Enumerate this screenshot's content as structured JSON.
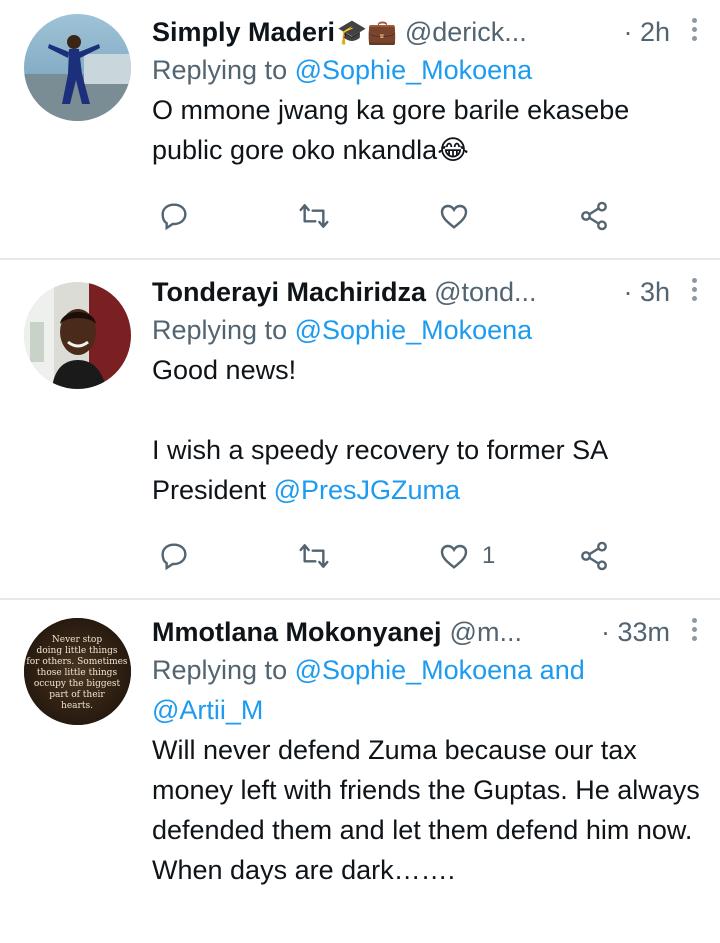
{
  "tweets": [
    {
      "name": "Simply Maderi",
      "badges": "🎓💼",
      "handle": "@derick...",
      "time": "· 2h",
      "reply_prefix": "Replying to",
      "reply_mention": "@Sophie_Mokoena",
      "text": "O mmone jwang ka gore barile ekasebe public gore oko nkandla😂",
      "likes": ""
    },
    {
      "name": "Tonderayi Machiridza",
      "handle": "@tond...",
      "time": "· 3h",
      "reply_prefix": "Replying to",
      "reply_mention": "@Sophie_Mokoena",
      "text_line1": "Good news!",
      "text_line2": "I wish a speedy recovery to  former SA President",
      "text_mention": "@PresJGZuma",
      "likes": "1"
    },
    {
      "name": "Mmotlana Mokonyanej",
      "handle": "@m...",
      "time": "· 33m",
      "reply_prefix": "Replying to",
      "reply_mention": "@Sophie_Mokoena and",
      "reply_mention2": "@Artii_M",
      "avatar_text": "Never stop doing little things for others. Sometimes those little things occupy the biggest part of their hearts.",
      "text": "Will never defend Zuma because our tax money left with friends the Guptas. He always defended them and let them defend him now.",
      "text_last": "When days are dark……."
    }
  ],
  "icons": [
    "reply-icon",
    "retweet-icon",
    "like-icon",
    "share-icon",
    "more-icon"
  ],
  "colors": {
    "link": "#1d9bf0",
    "secondary": "#536471",
    "divider": "#e4e8ec"
  }
}
